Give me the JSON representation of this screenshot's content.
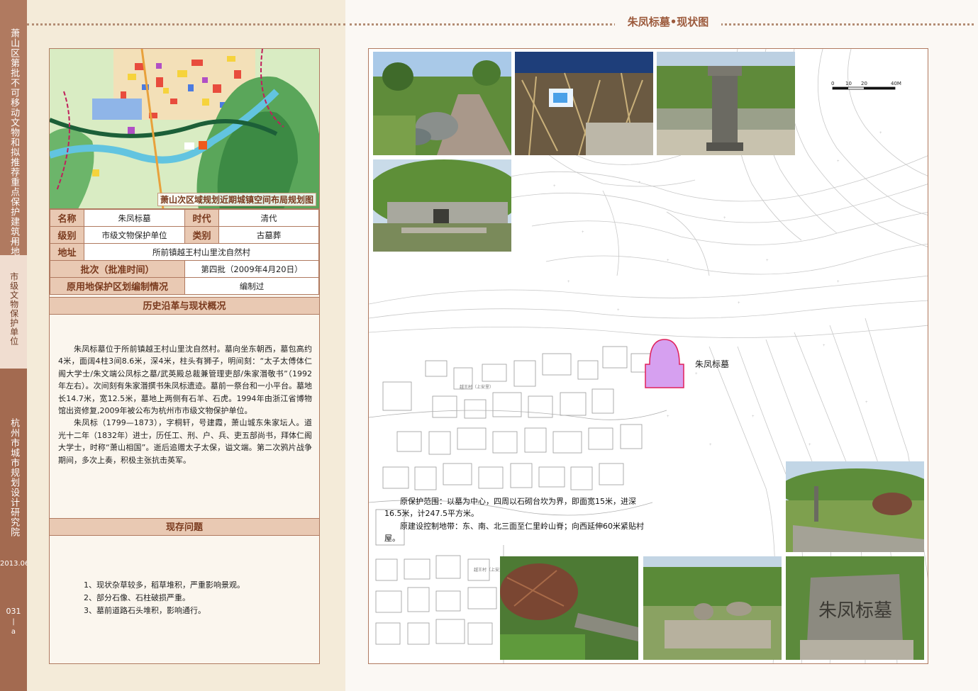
{
  "strip": {
    "series": "萧山区第批不可移动文物和拟推荐重点保护建筑用地规划",
    "dash": "—",
    "category": "市级文物保护单位",
    "institute": "杭州市城市规划设计研究院",
    "date": "2013.06",
    "page_number": "031",
    "page_sep": "|",
    "page_suffix": "a"
  },
  "map": {
    "caption": "萧山次区域规划近期城镇空间布局规划图"
  },
  "attributes": {
    "name_label": "名称",
    "name_value": "朱凤标墓",
    "era_label": "时代",
    "era_value": "清代",
    "level_label": "级别",
    "level_value": "市级文物保护单位",
    "type_label": "类别",
    "type_value": "古墓葬",
    "address_label": "地址",
    "address_value": "所前镇越王村山里沈自然村",
    "batch_label": "批次（批准时间）",
    "batch_value": "第四批（2009年4月20日）",
    "plan_label": "原用地保护区划编制情况",
    "plan_value": "编制过"
  },
  "history": {
    "heading": "历史沿革与现状概况",
    "paragraphs": [
      "朱凤标墓位于所前镇越王村山里沈自然村。墓向坐东朝西，墓包高约4米，面阔4柱3间8.6米，深4米，柱头有狮子，明间刻：“太子太傅体仁阁大学士/朱文端公凤标之墓/武英殿总裁兼管理吏部/朱家湣敬书”（1992年左右）。次间刻有朱家湣撰书朱凤标遗迹。墓前一祭台和一小平台。墓地长14.7米，宽12.5米，墓地上两侧有石羊、石虎。1994年由浙江省博物馆出资修复,2009年被公布为杭州市市级文物保护单位。",
      "朱凤标（1799—1873），字桐轩，号建霞，萧山城东朱家坛人。道光十二年（1832年）进士，历任工、刑、户、兵、吏五部尚书，拜体仁阁大学士，时称“萧山相国”。逝后追赠太子太保，谥文端。第二次鸦片战争期间，多次上奏，积极主张抗击英军。"
    ]
  },
  "issues": {
    "heading": "现存问题",
    "items": [
      "1、现状杂草较多，稻草堆积，严重影响景观。",
      "2、部分石像、石柱破损严重。",
      "3、墓前道路石头堆积，影响通行。"
    ]
  },
  "right": {
    "title": "朱凤标墓•现状图",
    "tomb_label": "朱凤标墓",
    "note": [
      "原保护范围：以墓为中心，四周以石砌台坎为界，即面宽15米，进深16.5米，计247.5平方米。",
      "原建设控制地带：东、南、北三面至仁里岭山脊；向西延伸60米紧贴村屋。"
    ],
    "village_labels": [
      "越王村（上安里）",
      "越王村（上安里）"
    ],
    "scale": {
      "ticks": [
        "0",
        "10",
        "20",
        "40M"
      ]
    },
    "stele_inscription": "朱凤标墓"
  }
}
